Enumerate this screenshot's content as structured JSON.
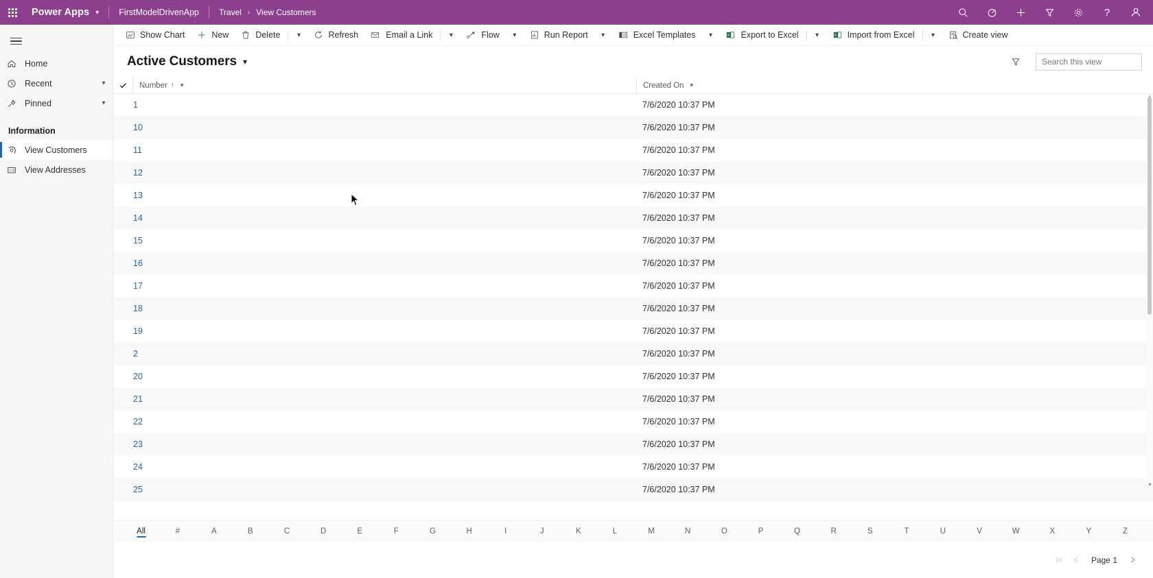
{
  "topbar": {
    "waffle_label": "app-launcher",
    "brand": "Power Apps",
    "app_name": "FirstModelDrivenApp",
    "breadcrumb_parent": "Travel",
    "breadcrumb_sep": "›",
    "breadcrumb_current": "View Customers",
    "brand_color": "#8c3f8c",
    "icons": [
      {
        "name": "search-icon",
        "glyph": "search"
      },
      {
        "name": "target-icon",
        "glyph": "target"
      },
      {
        "name": "add-icon",
        "glyph": "plus"
      },
      {
        "name": "filter-icon",
        "glyph": "funnel"
      },
      {
        "name": "settings-gear-icon",
        "glyph": "gear"
      },
      {
        "name": "help-icon",
        "glyph": "question"
      },
      {
        "name": "user-account-icon",
        "glyph": "person"
      }
    ]
  },
  "sidebar": {
    "hamburger_label": "Site Map",
    "items": [
      {
        "label": "Home",
        "icon": "home-icon",
        "has_chevron": false,
        "selected": false
      },
      {
        "label": "Recent",
        "icon": "clock-icon",
        "has_chevron": true,
        "selected": false
      },
      {
        "label": "Pinned",
        "icon": "pin-icon",
        "has_chevron": true,
        "selected": false
      }
    ],
    "group_heading": "Information",
    "group_items": [
      {
        "label": "View Customers",
        "icon": "entity-icon",
        "selected": true
      },
      {
        "label": "View Addresses",
        "icon": "address-card-icon",
        "selected": false
      }
    ],
    "accent_color": "#0f6cbd"
  },
  "commandbar": {
    "buttons": [
      {
        "label": "Show Chart",
        "icon": "chart-icon",
        "caret": false
      },
      {
        "label": "New",
        "icon": "plus-icon",
        "caret": false
      },
      {
        "label": "Delete",
        "icon": "trash-icon",
        "caret": true
      },
      {
        "label": "Refresh",
        "icon": "refresh-icon",
        "caret": false
      },
      {
        "label": "Email a Link",
        "icon": "email-link-icon",
        "caret": true
      },
      {
        "label": "Flow",
        "icon": "flow-icon",
        "caret": true
      },
      {
        "label": "Run Report",
        "icon": "report-icon",
        "caret": true
      },
      {
        "label": "Excel Templates",
        "icon": "excel-template-icon",
        "caret": true
      },
      {
        "label": "Export to Excel",
        "icon": "excel-export-icon",
        "caret": true
      },
      {
        "label": "Import from Excel",
        "icon": "excel-import-icon",
        "caret": true
      },
      {
        "label": "Create view",
        "icon": "create-view-icon",
        "caret": false
      }
    ]
  },
  "view": {
    "title": "Active Customers",
    "filter_icon": "funnel-icon",
    "search_placeholder": "Search this view",
    "search_value": "",
    "search_icon": "search-icon"
  },
  "grid": {
    "select_all_icon": "checkmark-icon",
    "columns": [
      {
        "label": "Number",
        "sorted": true,
        "sort_glyph": "↑"
      },
      {
        "label": "Created On",
        "sorted": false,
        "sort_glyph": ""
      }
    ],
    "rows": [
      {
        "number": "1",
        "created_on": "7/6/2020 10:37 PM"
      },
      {
        "number": "10",
        "created_on": "7/6/2020 10:37 PM"
      },
      {
        "number": "11",
        "created_on": "7/6/2020 10:37 PM"
      },
      {
        "number": "12",
        "created_on": "7/6/2020 10:37 PM"
      },
      {
        "number": "13",
        "created_on": "7/6/2020 10:37 PM"
      },
      {
        "number": "14",
        "created_on": "7/6/2020 10:37 PM"
      },
      {
        "number": "15",
        "created_on": "7/6/2020 10:37 PM"
      },
      {
        "number": "16",
        "created_on": "7/6/2020 10:37 PM"
      },
      {
        "number": "17",
        "created_on": "7/6/2020 10:37 PM"
      },
      {
        "number": "18",
        "created_on": "7/6/2020 10:37 PM"
      },
      {
        "number": "19",
        "created_on": "7/6/2020 10:37 PM"
      },
      {
        "number": "2",
        "created_on": "7/6/2020 10:37 PM"
      },
      {
        "number": "20",
        "created_on": "7/6/2020 10:37 PM"
      },
      {
        "number": "21",
        "created_on": "7/6/2020 10:37 PM"
      },
      {
        "number": "22",
        "created_on": "7/6/2020 10:37 PM"
      },
      {
        "number": "23",
        "created_on": "7/6/2020 10:37 PM"
      },
      {
        "number": "24",
        "created_on": "7/6/2020 10:37 PM"
      },
      {
        "number": "25",
        "created_on": "7/6/2020 10:37 PM"
      }
    ],
    "link_color": "#2266bb"
  },
  "alphabet_filter": {
    "active": "All",
    "items": [
      "All",
      "#",
      "A",
      "B",
      "C",
      "D",
      "E",
      "F",
      "G",
      "H",
      "I",
      "J",
      "K",
      "L",
      "M",
      "N",
      "O",
      "P",
      "Q",
      "R",
      "S",
      "T",
      "U",
      "V",
      "W",
      "X",
      "Y",
      "Z"
    ],
    "active_color": "#0f6cbd"
  },
  "pagination": {
    "first_page_label": "first-page",
    "prev_page_label": "previous-page",
    "page_label": "Page 1",
    "next_page_label": "next-page"
  }
}
